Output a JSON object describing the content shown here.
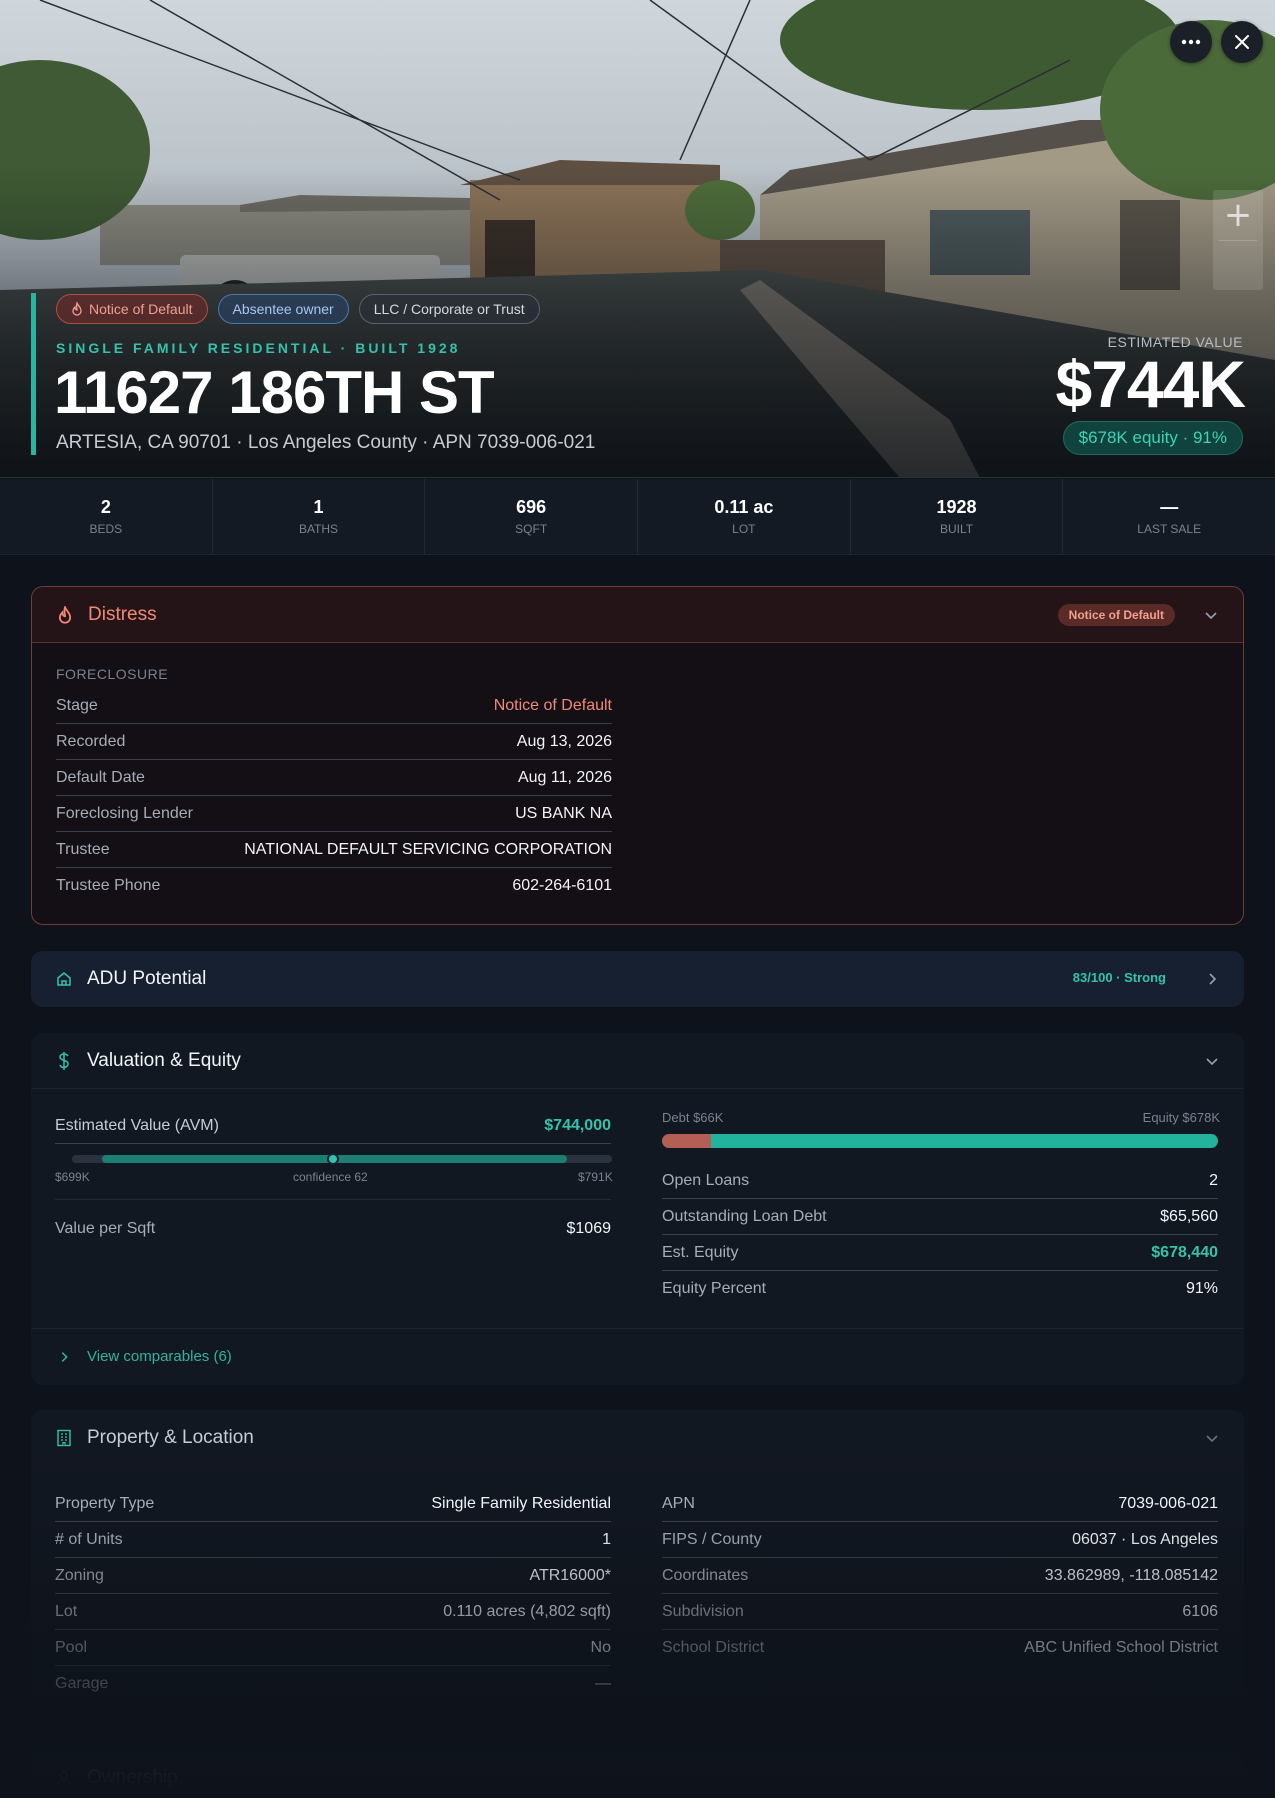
{
  "hero": {
    "tags": [
      "Notice of Default",
      "Absentee owner",
      "LLC / Corporate or Trust"
    ],
    "subtitle": "SINGLE FAMILY RESIDENTIAL · BUILT 1928",
    "address": "11627 186TH ST",
    "location": "ARTESIA, CA 90701 · Los Angeles County · APN 7039-006-021",
    "estimated_label": "ESTIMATED VALUE",
    "estimated_value": "$744K",
    "equity_pill": "$678K equity · 91%",
    "zoom_plus": "+"
  },
  "stats": [
    {
      "value": "2",
      "label": "BEDS"
    },
    {
      "value": "1",
      "label": "BATHS"
    },
    {
      "value": "696",
      "label": "SQFT"
    },
    {
      "value": "0.11 ac",
      "label": "LOT"
    },
    {
      "value": "1928",
      "label": "BUILT"
    },
    {
      "value": "—",
      "label": "LAST SALE"
    }
  ],
  "distress": {
    "title": "Distress",
    "badge": "Notice of Default",
    "section": "FORECLOSURE",
    "rows": [
      {
        "k": "Stage",
        "v": "Notice of Default"
      },
      {
        "k": "Recorded",
        "v": "Aug 13, 2026"
      },
      {
        "k": "Default Date",
        "v": "Aug 11, 2026"
      },
      {
        "k": "Foreclosing Lender",
        "v": "US BANK NA"
      },
      {
        "k": "Trustee",
        "v": "NATIONAL DEFAULT SERVICING CORPORATION"
      },
      {
        "k": "Trustee Phone",
        "v": "602-264-6101"
      }
    ]
  },
  "adu": {
    "title": "ADU Potential",
    "score": "83/100 · Strong"
  },
  "valuation": {
    "title": "Valuation & Equity",
    "avm_label": "Estimated Value (AVM)",
    "avm_value": "$744,000",
    "range_low": "$699K",
    "confidence": "confidence 62",
    "range_high": "$791K",
    "vps_label": "Value per Sqft",
    "vps_value": "$1069",
    "debt_label": "Debt $66K",
    "equity_label": "Equity $678K",
    "debt_fraction": 0.088,
    "rows": [
      {
        "k": "Open Loans",
        "v": "2"
      },
      {
        "k": "Outstanding Loan Debt",
        "v": "$65,560"
      },
      {
        "k": "Est. Equity",
        "v": "$678,440"
      },
      {
        "k": "Equity Percent",
        "v": "91%"
      }
    ],
    "comparables_link": "View comparables (6)"
  },
  "property": {
    "title": "Property & Location",
    "left": [
      {
        "k": "Property Type",
        "v": "Single Family Residential"
      },
      {
        "k": "# of Units",
        "v": "1"
      },
      {
        "k": "Zoning",
        "v": "ATR16000*"
      },
      {
        "k": "Lot",
        "v": "0.110 acres (4,802 sqft)"
      },
      {
        "k": "Pool",
        "v": "No"
      },
      {
        "k": "Garage",
        "v": "—"
      }
    ],
    "right": [
      {
        "k": "APN",
        "v": "7039-006-021"
      },
      {
        "k": "FIPS / County",
        "v": "06037 · Los Angeles"
      },
      {
        "k": "Coordinates",
        "v": "33.862989, -118.085142"
      },
      {
        "k": "Subdivision",
        "v": "6106"
      },
      {
        "k": "School District",
        "v": "ABC Unified School District"
      }
    ]
  },
  "ownership": {
    "title": "Ownership"
  },
  "colors": {
    "accent": "#2ab5a0",
    "distress": "#f08a76",
    "debt": "#b35f56",
    "equity": "#22b39c"
  }
}
